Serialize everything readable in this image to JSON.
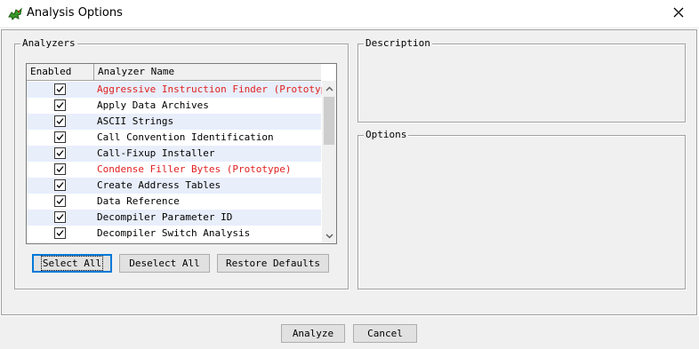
{
  "window": {
    "title": "Analysis Options",
    "close_icon": "close-icon"
  },
  "analyzers": {
    "group_label": "Analyzers",
    "columns": [
      "Enabled",
      "Analyzer Name"
    ],
    "rows": [
      {
        "name": "Aggressive Instruction Finder (Prototype)",
        "enabled": true,
        "prototype": true
      },
      {
        "name": "Apply Data Archives",
        "enabled": true,
        "prototype": false
      },
      {
        "name": "ASCII Strings",
        "enabled": true,
        "prototype": false
      },
      {
        "name": "Call Convention Identification",
        "enabled": true,
        "prototype": false
      },
      {
        "name": "Call-Fixup Installer",
        "enabled": true,
        "prototype": false
      },
      {
        "name": "Condense Filler Bytes (Prototype)",
        "enabled": true,
        "prototype": true
      },
      {
        "name": "Create Address Tables",
        "enabled": true,
        "prototype": false
      },
      {
        "name": "Data Reference",
        "enabled": true,
        "prototype": false
      },
      {
        "name": "Decompiler Parameter ID",
        "enabled": true,
        "prototype": false
      },
      {
        "name": "Decompiler Switch Analysis",
        "enabled": true,
        "prototype": false
      }
    ],
    "buttons": {
      "select_all": "Select All",
      "deselect_all": "Deselect All",
      "restore_defaults": "Restore Defaults"
    }
  },
  "description": {
    "label": "Description"
  },
  "options": {
    "label": "Options"
  },
  "footer": {
    "analyze": "Analyze",
    "cancel": "Cancel"
  },
  "colors": {
    "prototype_text": "#e02020",
    "alt_row": "#e8eefa",
    "default_button_border": "#0078d7"
  }
}
